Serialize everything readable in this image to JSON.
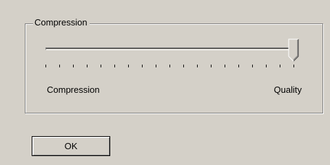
{
  "group": {
    "title": "Compression"
  },
  "slider": {
    "value_fraction": 1.0,
    "tick_count": 19,
    "min_label": "Compression",
    "max_label": "Quality"
  },
  "buttons": {
    "ok_label": "OK"
  }
}
